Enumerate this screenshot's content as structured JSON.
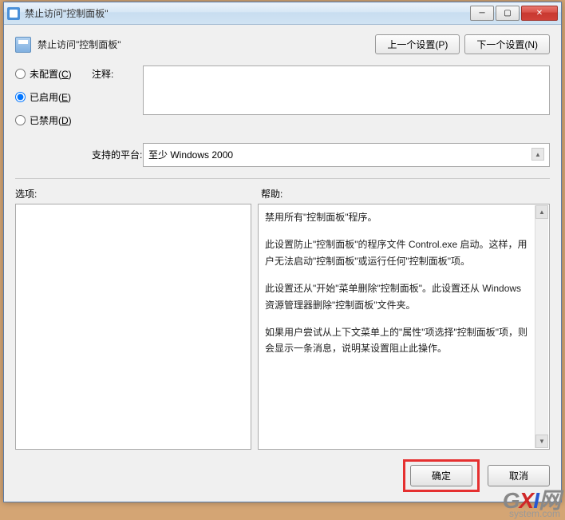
{
  "titlebar": {
    "title": "禁止访问\"控制面板\""
  },
  "header": {
    "title": "禁止访问\"控制面板\"",
    "prev_button": "上一个设置(P)",
    "next_button": "下一个设置(N)"
  },
  "radios": {
    "not_configured": "未配置(C)",
    "enabled": "已启用(E)",
    "disabled": "已禁用(D)",
    "selected": "enabled"
  },
  "comment": {
    "label": "注释:",
    "value": ""
  },
  "platform": {
    "label": "支持的平台:",
    "value": "至少 Windows 2000"
  },
  "panels": {
    "options_label": "选项:",
    "help_label": "帮助:",
    "help_paragraphs": [
      "禁用所有\"控制面板\"程序。",
      "此设置防止\"控制面板\"的程序文件 Control.exe 启动。这样，用户无法启动\"控制面板\"或运行任何\"控制面板\"项。",
      "此设置还从\"开始\"菜单删除\"控制面板\"。此设置还从 Windows 资源管理器删除\"控制面板\"文件夹。",
      "如果用户尝试从上下文菜单上的\"属性\"项选择\"控制面板\"项，则会显示一条消息，说明某设置阻止此操作。"
    ]
  },
  "footer": {
    "ok": "确定",
    "cancel": "取消"
  },
  "watermark": {
    "line1_g": "G",
    "line1_x": "X",
    "line1_i": "I",
    "line1_rest": "网",
    "line2": "system.com"
  }
}
